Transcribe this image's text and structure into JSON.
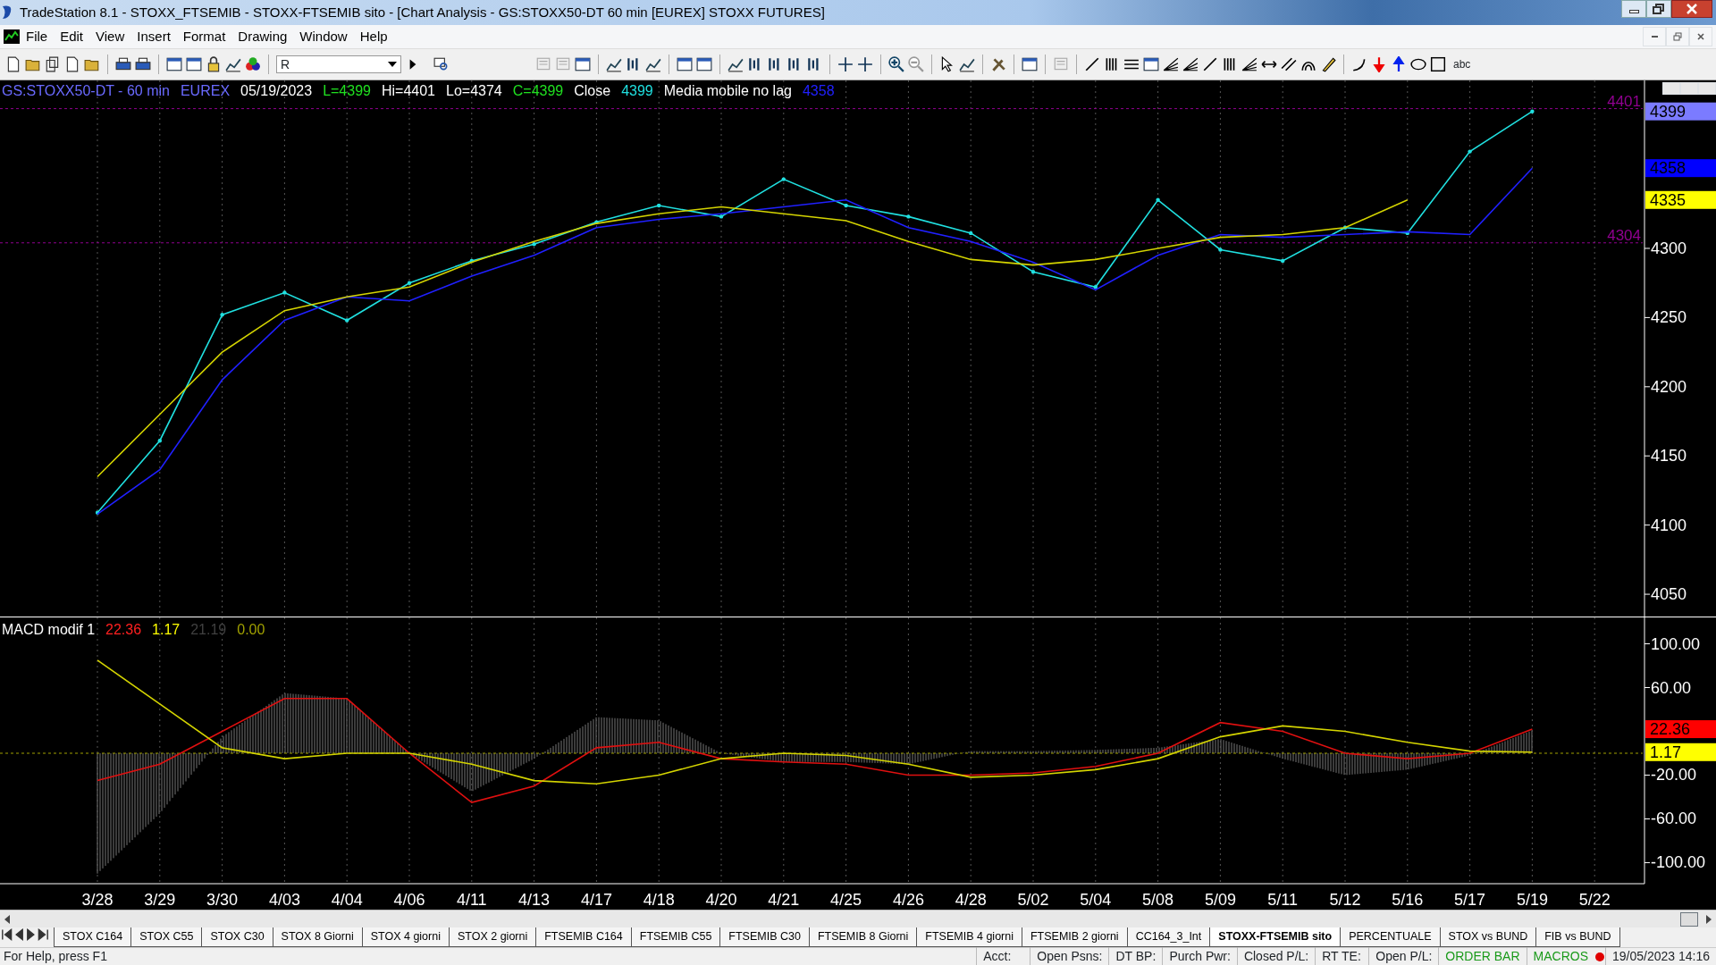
{
  "window": {
    "title": "TradeStation 8.1 - STOXX_FTSEMIB - STOXX-FTSEMIB sito - [Chart Analysis - GS:STOXX50-DT  60 min  [EUREX] STOXX FUTURES]"
  },
  "menu": [
    "File",
    "Edit",
    "View",
    "Insert",
    "Format",
    "Drawing",
    "Window",
    "Help"
  ],
  "toolbar": {
    "symbol_field": "R",
    "text_tool": "abc"
  },
  "price_panel": {
    "legend": [
      {
        "text": "GS:STOXX50-DT - 60 min",
        "color": "#6a6aff"
      },
      {
        "text": "EUREX",
        "color": "#6a6aff"
      },
      {
        "text": "05/19/2023",
        "color": "#ffffff"
      },
      {
        "text": "L=4399",
        "color": "#20e020"
      },
      {
        "text": "Hi=4401",
        "color": "#ffffff"
      },
      {
        "text": "Lo=4374",
        "color": "#ffffff"
      },
      {
        "text": "C=4399",
        "color": "#20e020"
      },
      {
        "text": "Close",
        "color": "#ffffff"
      },
      {
        "text": "4399",
        "color": "#20e0e0"
      },
      {
        "text": "Media mobile no lag",
        "color": "#ffffff"
      },
      {
        "text": "4358",
        "color": "#2020ff"
      }
    ],
    "axis_markers": [
      {
        "text": "4399",
        "color": "#7b7bff"
      },
      {
        "text": "4358",
        "color": "#0000ff"
      },
      {
        "text": "4335",
        "color": "#ffff00"
      }
    ],
    "chart_data": {
      "type": "line",
      "grid": true,
      "categories": [
        null,
        null,
        null,
        null,
        null,
        null,
        null,
        null,
        null,
        null,
        null,
        null,
        null,
        null,
        null,
        null,
        null,
        null,
        null,
        null,
        null,
        null,
        null,
        null,
        null
      ],
      "ylim": [
        4033.9,
        4421.4
      ],
      "series": [
        {
          "color": "#20e0e0",
          "values": [
            4109,
            4161,
            4252,
            4268,
            4248,
            4275,
            4291,
            4303,
            4319,
            4331,
            4323,
            4350,
            4331,
            4323,
            4311,
            4283,
            4272,
            4335,
            4299,
            4291,
            4315,
            4311,
            4370,
            4399,
            null
          ]
        },
        {
          "color": "#2020ff",
          "values": [
            4108,
            4140,
            4205,
            4248,
            4265,
            4262,
            4280,
            4295,
            4315,
            4321,
            4325,
            4330,
            4335,
            4315,
            4305,
            4290,
            4270,
            4295,
            4310,
            4308,
            4310,
            4312,
            4310,
            4358,
            null
          ]
        },
        {
          "color": "#d4d400",
          "values": [
            4135,
            4180,
            4225,
            4255,
            4265,
            4272,
            4290,
            4305,
            4318,
            4325,
            4330,
            4325,
            4320,
            4305,
            4292,
            4288,
            4292,
            4300,
            4308,
            4310,
            4315,
            4335,
            null,
            null,
            null
          ]
        }
      ],
      "yticks": [
        4050,
        4100,
        4150,
        4200,
        4250,
        4300
      ],
      "ref_lines": [
        {
          "axis": "y",
          "value": 4401,
          "label": "4401"
        },
        {
          "axis": "y",
          "value": 4304,
          "label": "4304"
        }
      ]
    }
  },
  "macd_panel": {
    "legend": [
      {
        "text": "MACD modif 1",
        "color": "#ffffff"
      },
      {
        "text": "22.36",
        "color": "#ff2020"
      },
      {
        "text": "1.17",
        "color": "#ffff00"
      },
      {
        "text": "21.19",
        "color": "#404040"
      },
      {
        "text": "0.00",
        "color": "#a0a000"
      }
    ],
    "axis_markers": [
      {
        "text": "22.36",
        "color": "#ff0000"
      },
      {
        "text": "1.17",
        "color": "#ffff00"
      }
    ],
    "chart_data": {
      "type": "line",
      "grid": true,
      "categories": [
        "3/28",
        "3/29",
        "3/30",
        "4/03",
        "4/04",
        "4/06",
        "4/11",
        "4/13",
        "4/17",
        "4/18",
        "4/20",
        "4/21",
        "4/25",
        "4/26",
        "4/28",
        "5/02",
        "5/04",
        "5/08",
        "5/09",
        "5/11",
        "5/12",
        "5/16",
        "5/17",
        "5/19",
        "5/22"
      ],
      "series": [
        {
          "color": "#e01010",
          "values": [
            -25,
            -10,
            20,
            50,
            50,
            0,
            -45,
            -30,
            5,
            10,
            -5,
            -8,
            -10,
            -20,
            -20,
            -18,
            -12,
            0,
            28,
            20,
            0,
            -5,
            0,
            22,
            null
          ]
        },
        {
          "color": "#d4d400",
          "values": [
            85,
            45,
            5,
            -5,
            0,
            0,
            -10,
            -25,
            -28,
            -20,
            -5,
            0,
            -2,
            -10,
            -22,
            -20,
            -15,
            -5,
            15,
            25,
            20,
            10,
            2,
            1,
            null
          ]
        }
      ],
      "yticks": [
        {
          "value": 100,
          "label": "100.00"
        },
        {
          "value": 60,
          "label": "60.00"
        },
        {
          "value": -20,
          "label": "-20.00"
        },
        {
          "value": -60,
          "label": "-60.00"
        },
        {
          "value": -100,
          "label": "-100.00"
        }
      ],
      "ylim": [
        -119.2,
        124.1
      ],
      "ref_lines": [
        {
          "axis": "y",
          "value": 0
        }
      ]
    }
  },
  "sheet_tabs": [
    {
      "label": "STOX C164",
      "selected": false
    },
    {
      "label": "STOX C55",
      "selected": false
    },
    {
      "label": "STOX  C30",
      "selected": false
    },
    {
      "label": "STOX  8 Giorni",
      "selected": false
    },
    {
      "label": "STOX 4 giorni",
      "selected": false
    },
    {
      "label": "STOX  2 giorni",
      "selected": false
    },
    {
      "label": "FTSEMIB C164",
      "selected": false
    },
    {
      "label": "FTSEMIB C55",
      "selected": false
    },
    {
      "label": "FTSEMIB C30",
      "selected": false
    },
    {
      "label": "FTSEMIB  8 Giorni",
      "selected": false
    },
    {
      "label": "FTSEMIB  4 giorni",
      "selected": false
    },
    {
      "label": "FTSEMIB  2 giorni",
      "selected": false
    },
    {
      "label": "CC164_3_Int",
      "selected": false
    },
    {
      "label": "STOXX-FTSEMIB sito",
      "selected": true
    },
    {
      "label": "PERCENTUALE",
      "selected": false
    },
    {
      "label": "STOX vs BUND",
      "selected": false
    },
    {
      "label": "FIB vs BUND",
      "selected": false
    }
  ],
  "status_bar": {
    "help": "For Help, press F1",
    "fields": [
      "Acct:",
      "Open Psns:",
      "DT BP:",
      "Purch Pwr:",
      "Closed P/L:",
      "RT TE:",
      "Open P/L:"
    ],
    "indicators": [
      "ORDER BAR",
      "MACROS"
    ],
    "datetime": "19/05/2023 14:16"
  }
}
